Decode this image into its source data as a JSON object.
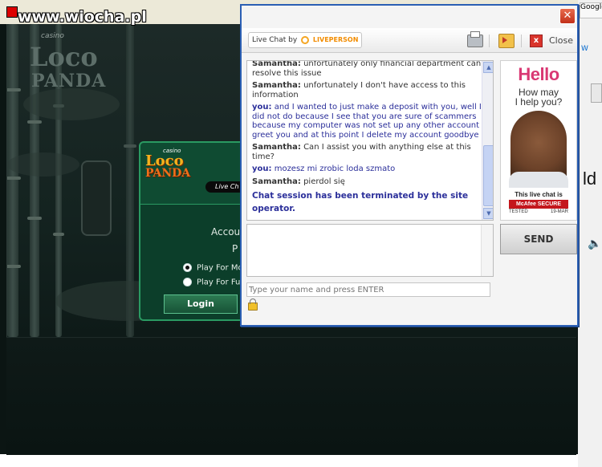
{
  "watermark": {
    "site": "www.wiocha.pl"
  },
  "background_browser": {
    "google_tab": "Google",
    "win_link": "W",
    "partial_text": "ld"
  },
  "casino": {
    "logo_casino": "casino",
    "logo_loco": "Loco",
    "logo_panda": "PANDA",
    "live_chat_pill": "Live Ch",
    "account_text": "Accou",
    "pa_text": "P",
    "radio_options": [
      {
        "label": "Play For Mo",
        "selected": true
      },
      {
        "label": "Play For Fu",
        "selected": false
      }
    ],
    "login_label": "Login"
  },
  "chat": {
    "close_x": "✕",
    "header": {
      "live_chat_by": "Live Chat by",
      "brand": "LIVEPERSON",
      "close_label": "Close"
    },
    "messages": [
      {
        "sender": "Samantha:",
        "text": "unfortunately only financial department can resolve this issue",
        "type": "agent"
      },
      {
        "sender": "Samantha:",
        "text": "unfortunately I don't have access to this information",
        "type": "agent"
      },
      {
        "sender": "you:",
        "text": "and I wanted to just make a deposit with you, well I did not do because I see that you are sure of scammers because my computer was not set up any other account greet you and at this point I delete my account goodbye",
        "type": "visitor"
      },
      {
        "sender": "Samantha:",
        "text": "Can I assist you with anything else at this time?",
        "type": "agent"
      },
      {
        "sender": "you:",
        "text": "mozesz mi zrobic loda szmato",
        "type": "visitor"
      },
      {
        "sender": "Samantha:",
        "text": "pierdol się",
        "type": "agent"
      }
    ],
    "system_message": "Chat session has been terminated by the site operator.",
    "name_input": {
      "placeholder": "Type your name and press ENTER"
    },
    "send_label": "SEND",
    "ad": {
      "hello": "Hello",
      "line1": "How may",
      "line2": "I help you?",
      "secure_text": "This live chat is",
      "mcafee": "McAfee SECURE",
      "tested": "TESTED",
      "date": "19-MAR"
    }
  }
}
